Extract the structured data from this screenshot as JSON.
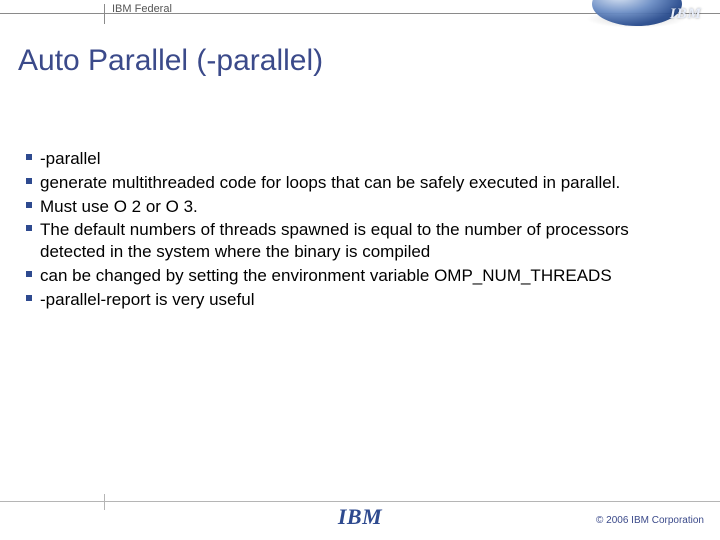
{
  "header": {
    "label": "IBM Federal",
    "logo": "IBM"
  },
  "title": "Auto Parallel (-parallel)",
  "bullets": [
    "-parallel",
    "generate multithreaded code for loops that can be safely executed in parallel.",
    "Must use O 2 or O 3.",
    "The default numbers of threads spawned is equal to the number of processors detected in the system where the binary is compiled",
    "can be changed by setting the environment variable OMP_NUM_THREADS",
    "-parallel-report is very useful"
  ],
  "footer": {
    "logo": "IBM",
    "copyright": "© 2006 IBM Corporation"
  }
}
